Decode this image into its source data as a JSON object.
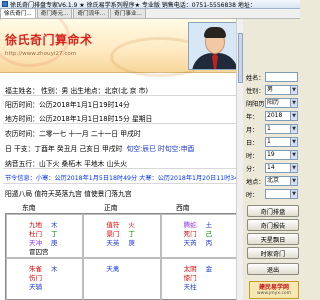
{
  "window": {
    "title": "徐氏奇门排盘专家V6.1.9 ★ 徐氏易学系列程序★ 专业版   销售电话：0751-5556838   地址："
  },
  "tabs": [
    {
      "label": "徐氏奇门..."
    },
    {
      "label": "奇门寿元..."
    },
    {
      "label": "奇门流年..."
    },
    {
      "label": "奇门事业..."
    }
  ],
  "doc": {
    "heading": "徐氏奇门算命术",
    "url": "http://www.zhouyi27.com",
    "person": "福主姓名：  性别：男  出生地点：北京(北 京 市)",
    "solar": "阳历时间：公历2018年1月1日19时14分",
    "true_solar": "地方时间：公历2018年1月1日18时15分 星期日",
    "lunar": "农历时间：二零一七 十一月 二十一日 甲戌时",
    "bazi_label": "日 干支：",
    "bazi": "丁酉年 癸丑月 己亥日 甲戌时",
    "bazi_extra": "旬空:辰巳 时旬空:申酉",
    "nayin": "纳音五行：山下火 桑柘木 平地木 山头火",
    "jieqi": "节令信息：小寒：公历2018年1月5日18时49分 大寒：公历2018年1月20日11时34分",
    "ju": "阳遁八局  值符天英落九宫  值使景门落九宫",
    "directions": {
      "se": "东南",
      "s": "正南",
      "sw": "西南"
    }
  },
  "palaces": [
    {
      "lines": [
        {
          "a": "九地",
          "b": "木",
          "ac": "red",
          "bc": "blu"
        },
        {
          "a": "杜门",
          "b": "丁",
          "ac": "red",
          "bc": "grn"
        },
        {
          "a": "天冲",
          "b": "庚",
          "ac": "purple",
          "bc": "blu"
        },
        {
          "a": "冒囚宫",
          "b": "",
          "ac": "",
          "bc": ""
        }
      ]
    },
    {
      "lines": [
        {
          "a": "值符",
          "b": "火",
          "ac": "red",
          "bc": "red"
        },
        {
          "a": "景门",
          "b": "丁",
          "ac": "red",
          "bc": "grn"
        },
        {
          "a": "天英",
          "b": "庚",
          "ac": "blu",
          "bc": "blu"
        },
        {
          "a": "",
          "b": "",
          "ac": "",
          "bc": ""
        }
      ]
    },
    {
      "lines": [
        {
          "a": "腾蛇",
          "b": "土",
          "ac": "purple",
          "bc": "blu"
        },
        {
          "a": "死门",
          "b": "己",
          "ac": "red",
          "bc": "grn"
        },
        {
          "a": "天芮",
          "b": "丙",
          "ac": "blu",
          "bc": "blu"
        },
        {
          "a": "",
          "b": "",
          "ac": "",
          "bc": ""
        }
      ]
    },
    {
      "lines": [
        {
          "a": "朱雀",
          "b": "木",
          "ac": "red",
          "bc": "blu"
        },
        {
          "a": "伤门",
          "b": "",
          "ac": "red",
          "bc": ""
        },
        {
          "a": "天辅",
          "b": "",
          "ac": "blu",
          "bc": ""
        },
        {
          "a": "",
          "b": "",
          "ac": "",
          "bc": ""
        }
      ]
    },
    {
      "lines": [
        {
          "a": "天禽",
          "b": "",
          "ac": "blu",
          "bc": ""
        },
        {
          "a": "",
          "b": "",
          "ac": "",
          "bc": ""
        },
        {
          "a": "",
          "b": "",
          "ac": "",
          "bc": ""
        },
        {
          "a": "",
          "b": "",
          "ac": "",
          "bc": ""
        }
      ]
    },
    {
      "lines": [
        {
          "a": "太阴",
          "b": "金",
          "ac": "red",
          "bc": "blu"
        },
        {
          "a": "惊门",
          "b": "",
          "ac": "red",
          "bc": ""
        },
        {
          "a": "天柱",
          "b": "",
          "ac": "blu",
          "bc": ""
        },
        {
          "a": "",
          "b": "",
          "ac": "",
          "bc": ""
        }
      ]
    }
  ],
  "form": {
    "name_label": "姓名：",
    "name_value": "",
    "sex_label": "性别：",
    "sex_value": "男",
    "calendar_label": "阴阳历：",
    "calendar_value": "阳历",
    "year_label": "年：",
    "year_value": "2018",
    "month_label": "月：",
    "month_value": "1",
    "day_label": "日：",
    "day_value": "1",
    "hour_label": "时：",
    "hour_value": "19",
    "minute_label": "分：",
    "minute_value": "14",
    "place_label": "地点：",
    "place_value": "北京",
    "extra_label": "时：",
    "extra_value": ""
  },
  "buttons": {
    "paipan": "奇门排盘",
    "baogao": "奇门报告",
    "chaxun": "天星飘日",
    "shijia": "时家奇门",
    "exit": "退出"
  },
  "stamp": {
    "line1": "建民易学网",
    "line2": "www.jmyx.com"
  }
}
